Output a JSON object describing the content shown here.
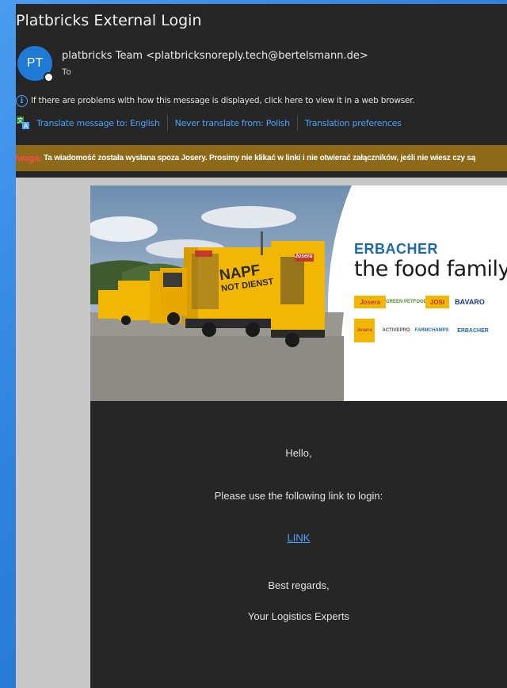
{
  "email": {
    "subject": "Platbricks External Login",
    "avatar_initials": "PT",
    "sender": "platbricks Team <platbricksnoreply.tech@bertelsmann.de>",
    "to_label": "To",
    "info_text": "If there are problems with how this message is displayed, click here to view it in a web browser.",
    "translate": {
      "translate_to": "Translate message to: English",
      "never_translate": "Never translate from: Polish",
      "preferences": "Translation preferences"
    },
    "warning": {
      "label": "Uwaga:",
      "text": "Ta wiadomość została wysłana spoza Josery. Prosimy nie klikać w linki i nie otwierać załączników, jeśli nie wiesz czy są"
    }
  },
  "banner": {
    "brand_title": "ERBACHER",
    "brand_subtitle": "the food family",
    "truck_text_1": "NAPF",
    "truck_text_2": "NOT DIENST",
    "truck_logo": "Josera",
    "logos": [
      "Josera",
      "GREEN PETFOOD",
      "JOSI",
      "BAVARO",
      "Josera",
      "ACTIVEPRO",
      "FARMCHAMPS",
      "ERBACHER"
    ]
  },
  "body": {
    "greeting": "Hello,",
    "instruction": "Please use the following link to login:",
    "link_label": "LINK",
    "closing": "Best regards,",
    "signature": "Your Logistics Experts"
  },
  "colors": {
    "background": "#3a8ee6",
    "window": "#262626",
    "link": "#4aa3ff",
    "warning_bar": "#8c6a1a",
    "brand_blue": "#1a6aa8",
    "truck_yellow": "#f2b705"
  }
}
